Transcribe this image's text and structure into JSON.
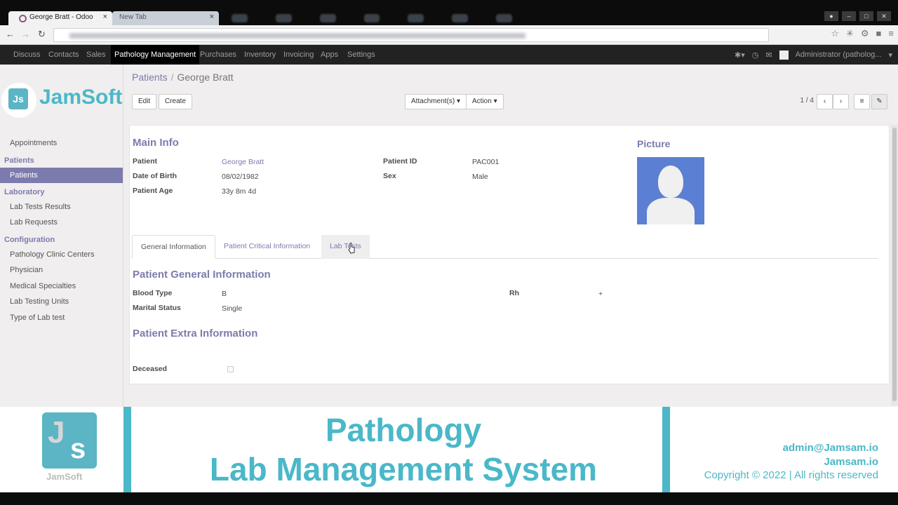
{
  "browser": {
    "tabs": [
      {
        "label": "George Bratt - Odoo",
        "close": "×"
      },
      {
        "label": "New Tab",
        "close": "×"
      }
    ]
  },
  "topmenu": {
    "items": [
      "Discuss",
      "Contacts",
      "Sales",
      "Pathology Management",
      "Purchases",
      "Inventory",
      "Invoicing",
      "Apps",
      "Settings"
    ],
    "active": "Pathology Management",
    "user": "Administrator (patholog..."
  },
  "sidebar": {
    "logo_text": "JamSoft",
    "logo_mark": "Js",
    "items_top": [
      "Appointments"
    ],
    "sections": [
      {
        "title": "Patients",
        "items": [
          "Patients"
        ]
      },
      {
        "title": "Laboratory",
        "items": [
          "Lab Tests Results",
          "Lab Requests"
        ]
      },
      {
        "title": "Configuration",
        "items": [
          "Pathology Clinic Centers",
          "Physician",
          "Medical Specialties",
          "Lab Testing Units",
          "Type of Lab test"
        ]
      }
    ],
    "active_item": "Patients"
  },
  "breadcrumb": {
    "parent": "Patients",
    "separator": "/",
    "current": "George Bratt"
  },
  "toolbar": {
    "edit": "Edit",
    "create": "Create",
    "attachments": "Attachment(s) ▾",
    "action": "Action ▾",
    "pager": "1 / 4"
  },
  "form": {
    "main_info": "Main Info",
    "picture": "Picture",
    "patient_label": "Patient",
    "patient_value": "George Bratt",
    "dob_label": "Date of Birth",
    "dob_value": "08/02/1982",
    "age_label": "Patient Age",
    "age_value": "33y 8m 4d",
    "pid_label": "Patient ID",
    "pid_value": "PAC001",
    "sex_label": "Sex",
    "sex_value": "Male",
    "tabs": [
      "General Information",
      "Patient Critical Information",
      "Lab Tests"
    ],
    "general_title": "Patient General Information",
    "blood_label": "Blood Type",
    "blood_value": "B",
    "rh_label": "Rh",
    "rh_value": "+",
    "marital_label": "Marital Status",
    "marital_value": "Single",
    "extra_title": "Patient Extra Information",
    "deceased_label": "Deceased"
  },
  "banner": {
    "logo_j": "J",
    "logo_s": "s",
    "logo_sub": "JamSoft",
    "title_line1": "Pathology",
    "title_line2": "Lab Management System",
    "email": "admin@Jamsam.io",
    "brand": "Jamsam.io",
    "copyright": "Copyright © 2022 | All rights reserved"
  },
  "colors": {
    "accent": "#7c7bad",
    "banner": "#4ab8c8",
    "topbar": "#222222"
  }
}
